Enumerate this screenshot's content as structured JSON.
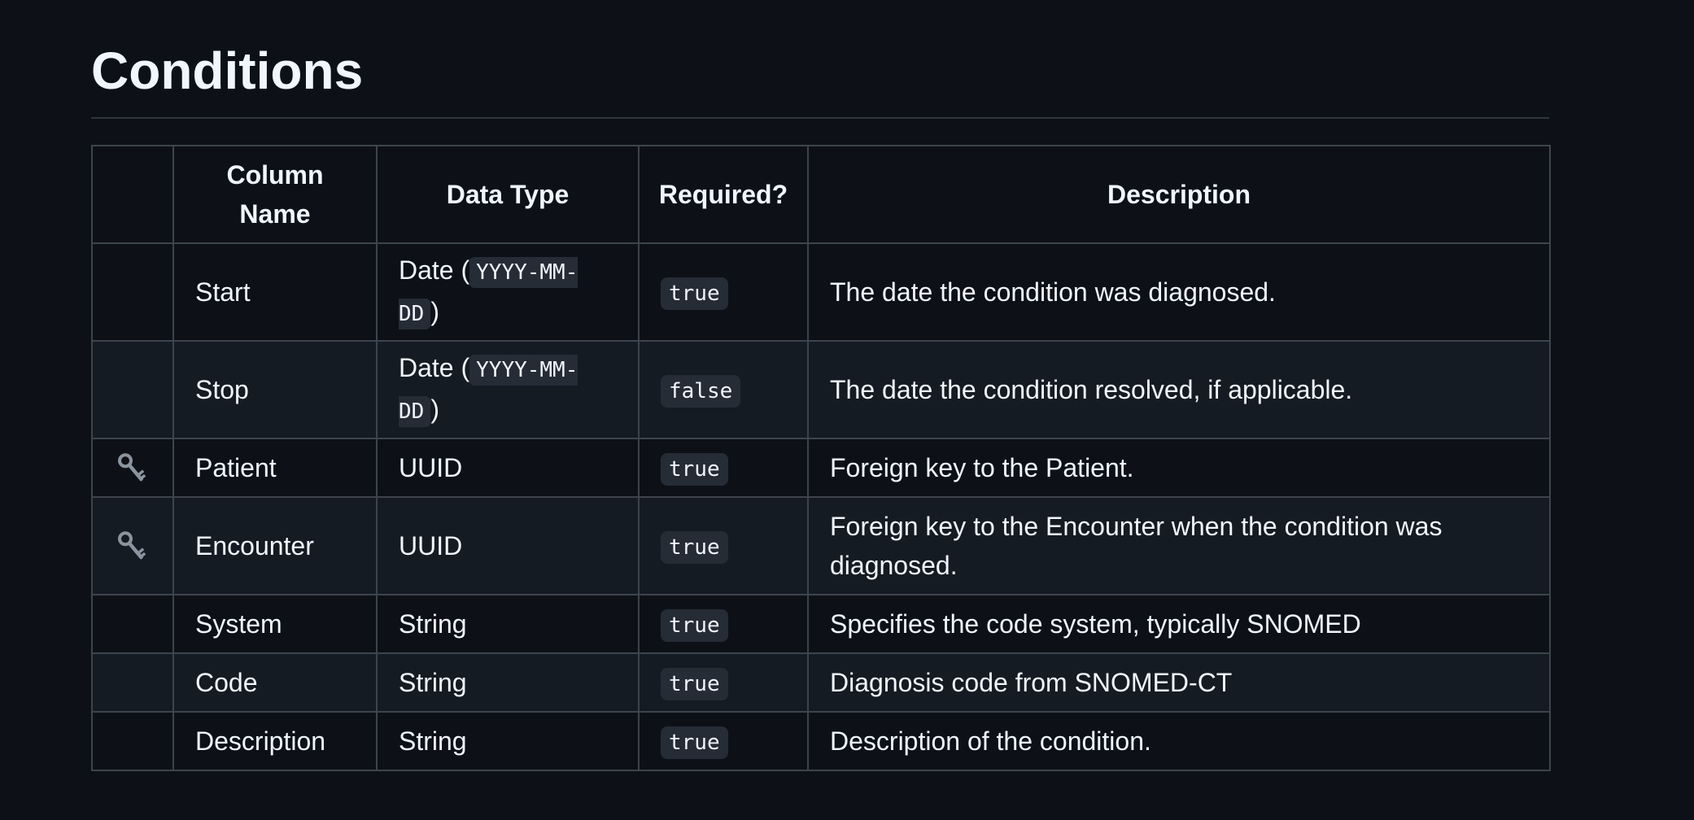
{
  "heading": "Conditions",
  "table": {
    "headers": [
      "",
      "Column Name",
      "Data Type",
      "Required?",
      "Description"
    ],
    "rows": [
      {
        "key": false,
        "name": "Start",
        "type_prefix": "Date (",
        "type_code": "YYYY-MM-DD",
        "type_suffix": ")",
        "required": "true",
        "description": "The date the condition was diagnosed."
      },
      {
        "key": false,
        "name": "Stop",
        "type_prefix": "Date (",
        "type_code": "YYYY-MM-DD",
        "type_suffix": ")",
        "required": "false",
        "description": "The date the condition resolved, if applicable."
      },
      {
        "key": true,
        "key_icon": "key-icon",
        "name": "Patient",
        "type": "UUID",
        "required": "true",
        "description": "Foreign key to the Patient."
      },
      {
        "key": true,
        "key_icon": "key-icon",
        "name": "Encounter",
        "type": "UUID",
        "required": "true",
        "description": "Foreign key to the Encounter when the condition was diagnosed."
      },
      {
        "key": false,
        "name": "System",
        "type": "String",
        "required": "true",
        "description": "Specifies the code system, typically SNOMED"
      },
      {
        "key": false,
        "name": "Code",
        "type": "String",
        "required": "true",
        "description": "Diagnosis code from SNOMED-CT"
      },
      {
        "key": false,
        "name": "Description",
        "type": "String",
        "required": "true",
        "description": "Description of the condition."
      }
    ]
  }
}
